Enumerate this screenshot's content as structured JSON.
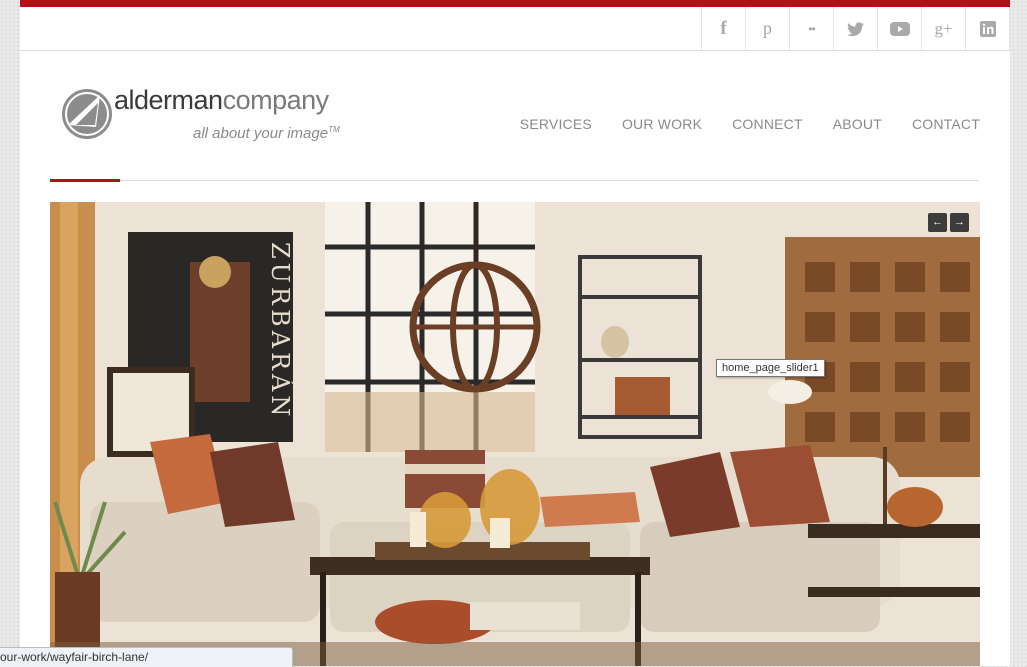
{
  "social": {
    "icons": [
      "facebook-icon",
      "pinterest-icon",
      "flickr-icon",
      "twitter-icon",
      "youtube-icon",
      "google-plus-icon",
      "linkedin-icon"
    ],
    "glyphs": [
      "f",
      "p",
      "••",
      "🐦",
      "▶",
      "g+",
      "in"
    ]
  },
  "logo": {
    "name_a": "alderman",
    "name_b": "company",
    "tagline": "all about your image",
    "tm": "TM"
  },
  "nav": {
    "services": "SERVICES",
    "our_work": "OUR WORK",
    "connect": "CONNECT",
    "about": "ABOUT",
    "contact": "CONTACT"
  },
  "slider": {
    "prev": "←",
    "next": "→",
    "tooltip": "home_page_slider1",
    "poster_text": "ZURBARÁN"
  },
  "status": {
    "url": "our-work/wayfair-birch-lane/"
  },
  "colors": {
    "accent": "#b41018"
  }
}
